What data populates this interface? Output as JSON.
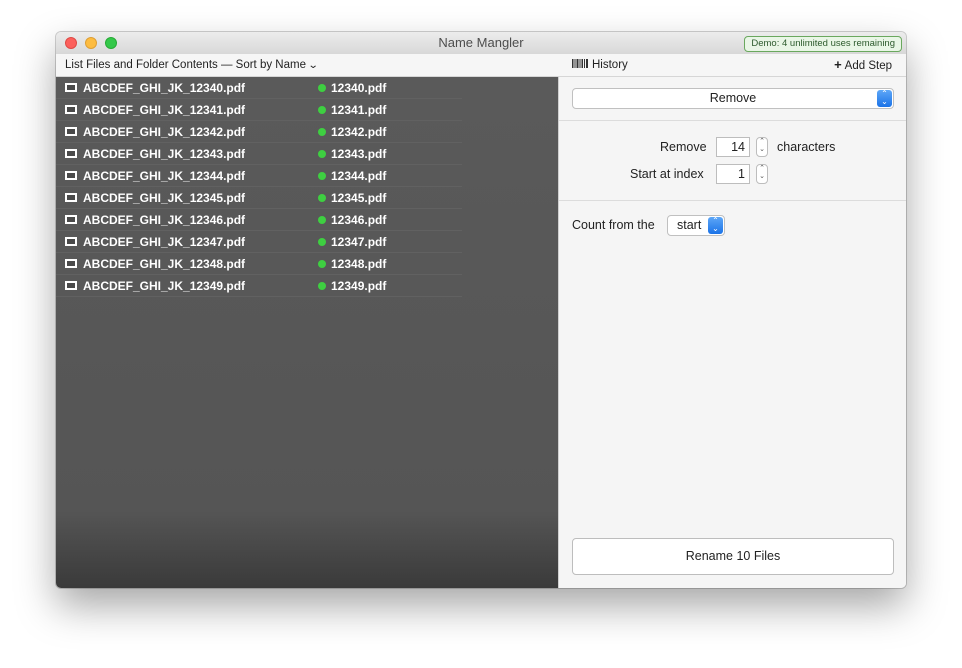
{
  "window": {
    "title": "Name Mangler",
    "demo_badge": "Demo: 4 unlimited uses remaining"
  },
  "toolbar": {
    "list_mode_label": "List Files and Folder Contents — Sort by Name",
    "history_label": "History",
    "add_step_label": "Add Step"
  },
  "files": [
    {
      "original": "ABCDEF_GHI_JK_12340.pdf",
      "renamed": "12340.pdf"
    },
    {
      "original": "ABCDEF_GHI_JK_12341.pdf",
      "renamed": "12341.pdf"
    },
    {
      "original": "ABCDEF_GHI_JK_12342.pdf",
      "renamed": "12342.pdf"
    },
    {
      "original": "ABCDEF_GHI_JK_12343.pdf",
      "renamed": "12343.pdf"
    },
    {
      "original": "ABCDEF_GHI_JK_12344.pdf",
      "renamed": "12344.pdf"
    },
    {
      "original": "ABCDEF_GHI_JK_12345.pdf",
      "renamed": "12345.pdf"
    },
    {
      "original": "ABCDEF_GHI_JK_12346.pdf",
      "renamed": "12346.pdf"
    },
    {
      "original": "ABCDEF_GHI_JK_12347.pdf",
      "renamed": "12347.pdf"
    },
    {
      "original": "ABCDEF_GHI_JK_12348.pdf",
      "renamed": "12348.pdf"
    },
    {
      "original": "ABCDEF_GHI_JK_12349.pdf",
      "renamed": "12349.pdf"
    }
  ],
  "step": {
    "action": "Remove",
    "remove_label": "Remove",
    "remove_count": "14",
    "remove_unit": "characters",
    "start_index_label": "Start at index",
    "start_index": "1",
    "count_from_label": "Count from the",
    "count_from_value": "start"
  },
  "rename_button": "Rename 10 Files",
  "colors": {
    "status_ok": "#3ecf41",
    "list_background": "#555555",
    "accent": "#1b73e8"
  }
}
